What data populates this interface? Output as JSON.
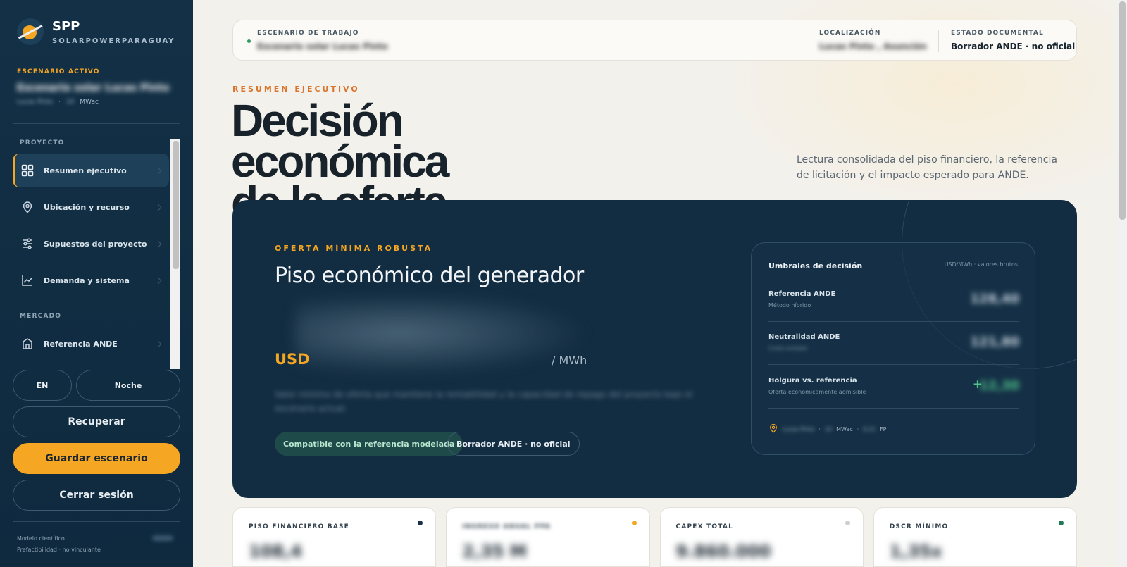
{
  "brand": {
    "title": "SPP",
    "subtitle": "SOLARPOWERPARAGUAY"
  },
  "active_scenario": {
    "label": "ESCENARIO ACTIVO",
    "name": "Escenario solar Lucas Pinto",
    "location": "Lucas Pinto",
    "capacity": "10",
    "capacity_unit": "MWac"
  },
  "nav": {
    "sections": [
      {
        "title": "PROYECTO",
        "items": [
          {
            "label": "Resumen ejecutivo",
            "icon": "grid-icon",
            "active": true
          },
          {
            "label": "Ubicación y recurso",
            "icon": "map-pin-icon"
          },
          {
            "label": "Supuestos del proyecto",
            "icon": "sliders-icon"
          },
          {
            "label": "Demanda y sistema",
            "icon": "line-chart-icon"
          }
        ]
      },
      {
        "title": "MERCADO",
        "items": [
          {
            "label": "Referencia ANDE",
            "icon": "building-icon"
          }
        ]
      }
    ]
  },
  "controls": {
    "lang": "EN",
    "theme": "Noche",
    "recover": "Recuperar",
    "save": "Guardar escenario",
    "logout": "Cerrar sesión"
  },
  "footer": {
    "line1": "Modelo científico",
    "line2": "Prefactibilidad · no vinculante"
  },
  "topbar": {
    "scenario_label": "ESCENARIO DE TRABAJO",
    "scenario_value": "Escenario solar Lucas Pinto",
    "location_label": "LOCALIZACIÓN",
    "location_value": "Lucas Pinto , Asunción",
    "status_label": "ESTADO DOCUMENTAL",
    "status_value": "Borrador ANDE · no oficial"
  },
  "header": {
    "eyebrow": "RESUMEN EJECUTIVO",
    "title_line1": "Decisión económica",
    "title_line2": "de la oferta",
    "lede": "Lectura consolidada del piso financiero, la referencia de licitación y el impacto esperado para ANDE."
  },
  "hero": {
    "eyebrow": "OFERTA MÍNIMA ROBUSTA",
    "title": "Piso económico del generador",
    "currency": "USD",
    "unit": "/ MWh",
    "description": "Valor mínimo de oferta que mantiene la rentabilidad y la capacidad de repago del proyecto bajo el escenario actual.",
    "badge_ok": "Compatible con la referencia modelada",
    "badge_draft": "Borrador ANDE · no oficial"
  },
  "thresholds": {
    "title": "Umbrales de decisión",
    "units": "USD/MWh · valores brutos",
    "rows": [
      {
        "label": "Referencia ANDE",
        "sub": "Método híbrido",
        "value": "128,40"
      },
      {
        "label": "Neutralidad ANDE",
        "sub": "Costo evitado",
        "value": "121,80"
      },
      {
        "label": "Holgura vs. referencia",
        "sub": "Oferta económicamente admisible",
        "value": "12,30"
      }
    ],
    "footer_location": "Lucas Pinto",
    "footer_capacity": "10",
    "footer_capacity_unit": "MWac",
    "footer_fp": "0,21",
    "footer_fp_unit": "FP",
    "sep": "·"
  },
  "kpis": [
    {
      "label": "PISO FINANCIERO BASE",
      "value": "108,4",
      "dot": "#17324a"
    },
    {
      "label": "INGRESO ANUAL PPA",
      "value": "2,35 M",
      "dot": "#f5a623"
    },
    {
      "label": "CAPEX TOTAL",
      "value": "9.860.000",
      "dot": "#cfcfcf"
    },
    {
      "label": "DSCR MÍNIMO",
      "value": "1,35x",
      "dot": "#1f7a55"
    }
  ]
}
